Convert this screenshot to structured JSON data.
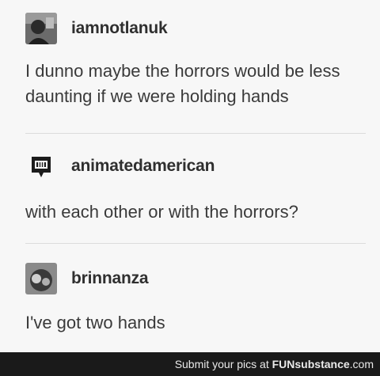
{
  "posts": [
    {
      "username": "iamnotlanuk",
      "avatar_icon": "user-avatar-photo",
      "text_lines": [
        "I dunno maybe the horrors would be less",
        "daunting if we were holding hands"
      ]
    },
    {
      "username": "animatedamerican",
      "avatar_icon": "speech-bubble-logo-icon",
      "text_lines": [
        "with each other or with the horrors?"
      ]
    },
    {
      "username": "brinnanza",
      "avatar_icon": "user-avatar-photo",
      "text_lines": [
        "I've got two hands"
      ]
    }
  ],
  "footer": {
    "prefix": "Submit your pics at ",
    "brand": "FUNsubstance",
    "suffix": ".com"
  },
  "colors": {
    "background": "#f7f7f7",
    "footer_bg": "#1a1a1a",
    "divider": "#dcdcdc"
  }
}
